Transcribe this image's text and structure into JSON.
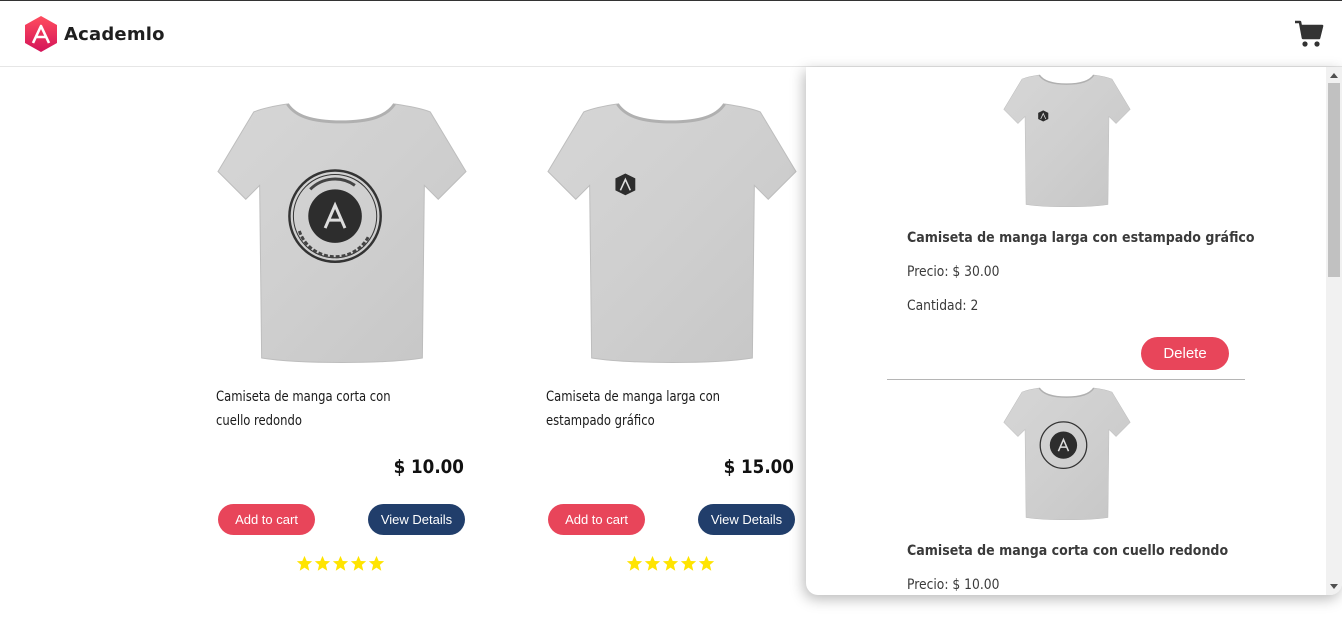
{
  "header": {
    "brand": "Academlo",
    "cart_icon": "shopping-cart-icon"
  },
  "products": [
    {
      "title": "Camiseta de manga corta con cuello redondo",
      "price": "$ 10.00",
      "add_label": "Add to cart",
      "view_label": "View Details",
      "rating": 5
    },
    {
      "title": "Camiseta de manga larga con estampado gráfico",
      "price": "$ 15.00",
      "add_label": "Add to cart",
      "view_label": "View Details",
      "rating": 5
    }
  ],
  "cart": {
    "items": [
      {
        "title": "Camiseta de manga larga con estampado gráfico",
        "price": "Precio: $ 30.00",
        "quantity": "Cantidad: 2",
        "delete_label": "Delete"
      },
      {
        "title": "Camiseta de manga corta con cuello redondo",
        "price": "Precio: $ 10.00"
      }
    ]
  },
  "colors": {
    "accent_red": "#e8455a",
    "accent_blue": "#213e6b",
    "star_yellow": "#ffe400",
    "brand_gradient": [
      "#ff3d5a",
      "#d4145a"
    ]
  }
}
